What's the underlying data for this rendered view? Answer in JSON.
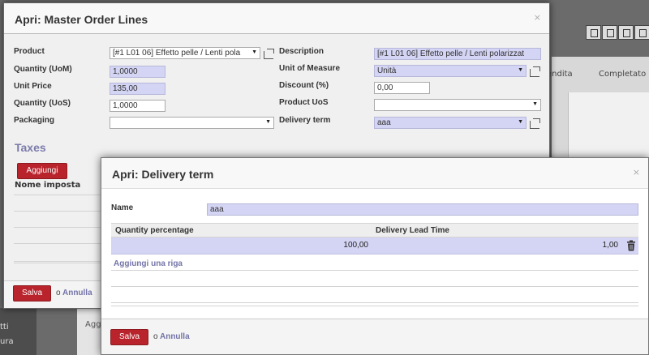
{
  "background": {
    "side_items": [
      "tti",
      "ura"
    ],
    "status_steps": [
      "endita",
      "Completato"
    ],
    "bottom_text": "Agg"
  },
  "modal1": {
    "title": "Apri: Master Order Lines",
    "close": "×",
    "fields": {
      "product_label": "Product",
      "product_value": "[#1 L01 06] Effetto pelle / Lenti pola",
      "quantity_uom_label": "Quantity (UoM)",
      "quantity_uom_value": "1,0000",
      "unit_price_label": "Unit Price",
      "unit_price_value": "135,00",
      "quantity_uos_label": "Quantity (UoS)",
      "quantity_uos_value": "1,0000",
      "packaging_label": "Packaging",
      "packaging_value": "",
      "description_label": "Description",
      "description_value": "[#1 L01 06] Effetto pelle / Lenti polarizzat",
      "uom_label": "Unit of Measure",
      "uom_value": "Unità",
      "discount_label": "Discount (%)",
      "discount_value": "0,00",
      "product_uos_label": "Product UoS",
      "product_uos_value": "",
      "delivery_term_label": "Delivery term",
      "delivery_term_value": "aaa"
    },
    "taxes_title": "Taxes",
    "add_button": "Aggiungi",
    "tax_column": "Nome imposta",
    "save": "Salva",
    "or": "o",
    "cancel": "Annulla"
  },
  "modal2": {
    "title": "Apri: Delivery term",
    "close": "×",
    "name_label": "Name",
    "name_value": "aaa",
    "columns": [
      "Quantity percentage",
      "Delivery Lead Time"
    ],
    "row": {
      "quantity_percentage": "100,00",
      "delivery_lead_time": "1,00"
    },
    "add_line": "Aggiungi una riga",
    "save": "Salva",
    "or": "o",
    "cancel": "Annulla"
  }
}
